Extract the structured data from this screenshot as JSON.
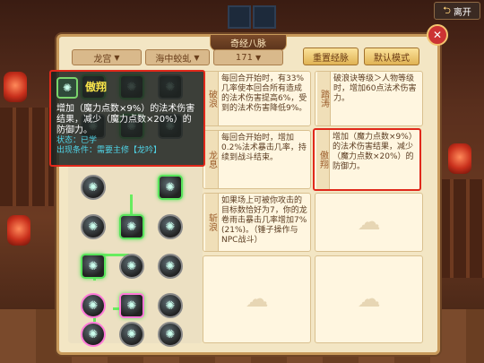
{
  "window": {
    "title": "奇经八脉",
    "back_label": "离开"
  },
  "tabs": [
    {
      "label": "龙宫"
    },
    {
      "label": "海中蛟虬"
    },
    {
      "label": "171"
    }
  ],
  "buttons": {
    "reset": "重置经脉",
    "default_mode": "默认模式"
  },
  "tooltip": {
    "skill_name": "傲翔",
    "description": "增加（魔力点数×9%）的法术伤害结果，减少（魔力点数×20%）的防御力。",
    "status_line1": "状态：已学",
    "status_line2": "出现条件：需要主修【龙吟】"
  },
  "cards": [
    {
      "label": "破浪",
      "text": "每回合开始时，有33%几率使本回合所有造成的法术伤害提高6%，受到的法术伤害降低9%。"
    },
    {
      "label": "踏涛",
      "text": "破浪诀等级＞人物等级时，增加60点法术伤害力。"
    },
    {
      "label": "龙息",
      "text": "每回合开始时，增加0.2%法术暴击几率，持续到战斗结束。"
    },
    {
      "label": "傲翔",
      "text": "增加（魔力点数×9%）的法术伤害结果，减少（魔力点数×20%）的防御力。",
      "highlight": true
    },
    {
      "label": "斩浪",
      "text": "如果场上可被你攻击的目标数恰好为7，你的龙卷雨击暴击几率增加7%(21%)。（锤子操作与NPC战斗）"
    },
    {
      "label": "",
      "text": ""
    },
    {
      "label": "",
      "text": ""
    },
    {
      "label": "",
      "text": ""
    }
  ],
  "icons": {
    "back": "arrow-left-icon",
    "close": "close-icon",
    "dropdown": "chevron-down-icon"
  }
}
